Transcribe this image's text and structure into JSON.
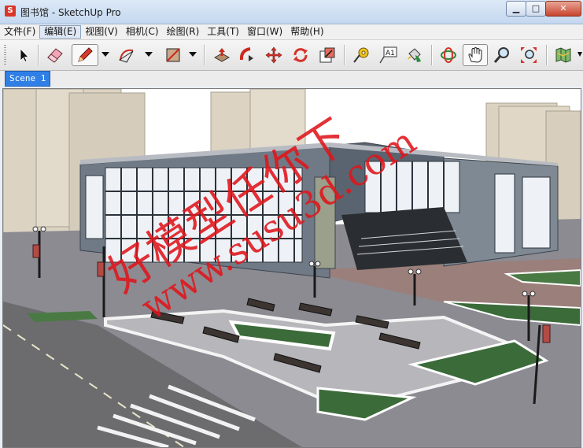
{
  "window": {
    "title": "图书馆 - SketchUp Pro",
    "minimize": "▁",
    "maximize": "□",
    "close": "✕"
  },
  "menu": [
    "文件(F)",
    "编辑(E)",
    "视图(V)",
    "相机(C)",
    "绘图(R)",
    "工具(T)",
    "窗口(W)",
    "帮助(H)"
  ],
  "menu_active_index": 1,
  "toolbar": {
    "tools": [
      "select-tool-icon",
      "eraser-tool-icon",
      "pencil-line-tool-icon",
      "arc-tool-icon",
      "rectangle-tool-icon",
      "push-pull-tool-icon",
      "follow-me-tool-icon",
      "move-tool-icon",
      "rotate-tool-icon",
      "scale-tool-icon",
      "tape-measure-tool-icon",
      "text-tool-icon",
      "paint-bucket-tool-icon",
      "orbit-tool-icon",
      "pan-tool-icon",
      "zoom-tool-icon",
      "zoom-extents-tool-icon",
      "map-tool-icon"
    ],
    "text_tool_label": "A1"
  },
  "scenes": {
    "active": "Scene 1"
  },
  "watermark": {
    "line1": "好模型任你下",
    "line2": "www.susu3d.com"
  },
  "colors": {
    "titlebar": "#c4d8ef",
    "scene_tab": "#2f7fe6",
    "watermark": "#e0151b",
    "sky": "#ffffff",
    "lawn": "#3c6b3a",
    "paving": "#8f8f96",
    "road": "#6d6d6d"
  }
}
